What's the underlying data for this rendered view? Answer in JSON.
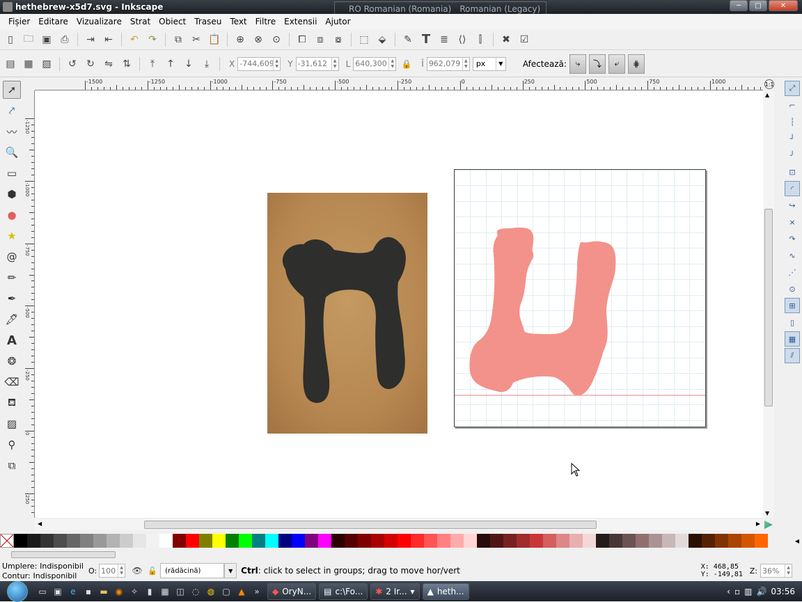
{
  "window": {
    "title": "hethebrew-x5d7.svg - Inkscape",
    "min": "─",
    "max": "□",
    "close": "✕"
  },
  "langbar": {
    "item1": "RO Romanian (Romania)",
    "item2": "Romanian (Legacy)"
  },
  "menu": [
    "Fișier",
    "Editare",
    "Vizualizare",
    "Strat",
    "Obiect",
    "Traseu",
    "Text",
    "Filtre",
    "Extensii",
    "Ajutor"
  ],
  "ctrl": {
    "x_label": "X",
    "x_value": "-744,609",
    "y_label": "Y",
    "y_value": "-31,612",
    "w_label": "L",
    "w_value": "640,300",
    "h_label": "Î",
    "h_value": "962,079",
    "unit": "px",
    "affect_label": "Afectează:"
  },
  "ruler": {
    "h": [
      "-1500",
      "-1250",
      "-1000",
      "-750",
      "-500",
      "-250",
      "0",
      "250",
      "500",
      "750",
      "1000"
    ],
    "v": [
      "-1250",
      "-1000",
      "-750",
      "-500",
      "-250",
      "0",
      "250"
    ]
  },
  "status": {
    "fill_label": "Umplere:",
    "fill_value": "Indisponibil",
    "stroke_label": "Contur:",
    "stroke_value": "Indisponibil",
    "opacity_label": "O:",
    "opacity_value": "100",
    "layer": "(rădăcină)",
    "message_key": "Ctrl",
    "message": ": click to select in groups; drag to move hor/vert",
    "coords_x": "X:  468,85",
    "coords_y": "Y: -149,81",
    "zoom_label": "Z:",
    "zoom_value": "36%"
  },
  "taskbar": {
    "tasks": [
      "OryN...",
      "c:\\Fo...",
      "2 Ir...",
      "heth..."
    ],
    "time": "03:56"
  },
  "palette": [
    "#000000",
    "#1a1a1a",
    "#333333",
    "#4d4d4d",
    "#666666",
    "#808080",
    "#999999",
    "#b3b3b3",
    "#cccccc",
    "#e6e6e6",
    "#f2f2f2",
    "#ffffff",
    "#800000",
    "#ff0000",
    "#808000",
    "#ffff00",
    "#008000",
    "#00ff00",
    "#008080",
    "#00ffff",
    "#000080",
    "#0000ff",
    "#800080",
    "#ff00ff",
    "#2b0000",
    "#550000",
    "#800000",
    "#aa0000",
    "#d40000",
    "#ff0000",
    "#ff2a2a",
    "#ff5555",
    "#ff8080",
    "#ffaaaa",
    "#ffd5d5",
    "#280b0b",
    "#501616",
    "#782121",
    "#a02c2c",
    "#c83737",
    "#d35f5f",
    "#de8787",
    "#e9afaf",
    "#f4d7d7",
    "#241c1c",
    "#483737",
    "#6c5353",
    "#916f6f",
    "#ac9393",
    "#c8b7b7",
    "#e3dbdb",
    "#2b1100",
    "#552200",
    "#803300",
    "#aa4400",
    "#d45500",
    "#ff6600"
  ]
}
